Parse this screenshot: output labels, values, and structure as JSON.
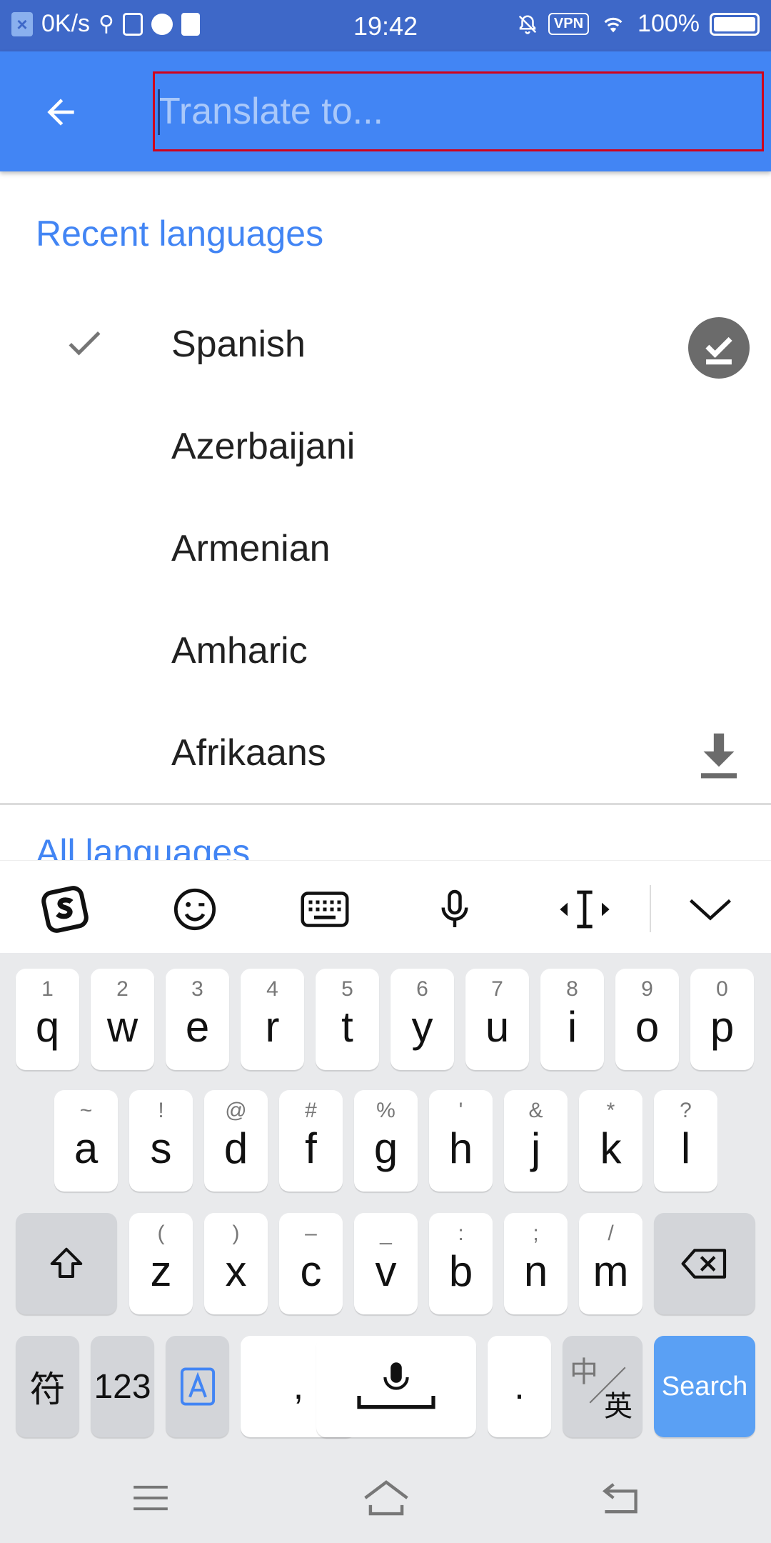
{
  "status_bar": {
    "speed": "0K/s",
    "time": "19:42",
    "vpn": "VPN",
    "battery": "100%"
  },
  "header": {
    "search_placeholder": "Translate to..."
  },
  "recent": {
    "title": "Recent languages",
    "items": [
      {
        "label": "Spanish",
        "selected": true,
        "action": "downloaded-check-icon"
      },
      {
        "label": "Azerbaijani"
      },
      {
        "label": "Armenian"
      },
      {
        "label": "Amharic"
      },
      {
        "label": "Afrikaans",
        "action": "download-icon"
      }
    ]
  },
  "all_languages": {
    "title": "All languages"
  },
  "keyboard": {
    "row1": [
      {
        "main": "q",
        "sub": "1"
      },
      {
        "main": "w",
        "sub": "2"
      },
      {
        "main": "e",
        "sub": "3"
      },
      {
        "main": "r",
        "sub": "4"
      },
      {
        "main": "t",
        "sub": "5"
      },
      {
        "main": "y",
        "sub": "6"
      },
      {
        "main": "u",
        "sub": "7"
      },
      {
        "main": "i",
        "sub": "8"
      },
      {
        "main": "o",
        "sub": "9"
      },
      {
        "main": "p",
        "sub": "0"
      }
    ],
    "row2": [
      {
        "main": "a",
        "sub": "~"
      },
      {
        "main": "s",
        "sub": "!"
      },
      {
        "main": "d",
        "sub": "@"
      },
      {
        "main": "f",
        "sub": "#"
      },
      {
        "main": "g",
        "sub": "%"
      },
      {
        "main": "h",
        "sub": "'"
      },
      {
        "main": "j",
        "sub": "&"
      },
      {
        "main": "k",
        "sub": "*"
      },
      {
        "main": "l",
        "sub": "?"
      }
    ],
    "row3": [
      {
        "main": "z",
        "sub": "("
      },
      {
        "main": "x",
        "sub": ")"
      },
      {
        "main": "c",
        "sub": "–"
      },
      {
        "main": "v",
        "sub": "_"
      },
      {
        "main": "b",
        "sub": ":"
      },
      {
        "main": "n",
        "sub": ";"
      },
      {
        "main": "m",
        "sub": "/"
      }
    ],
    "symbols_label": "符",
    "numbers_label": "123",
    "comma_label": ",",
    "period_label": ".",
    "lang_switch_top": "中",
    "lang_switch_bottom": "英",
    "search_label": "Search"
  },
  "accent_color": "#4285f4",
  "highlight_color": "#d0021b"
}
